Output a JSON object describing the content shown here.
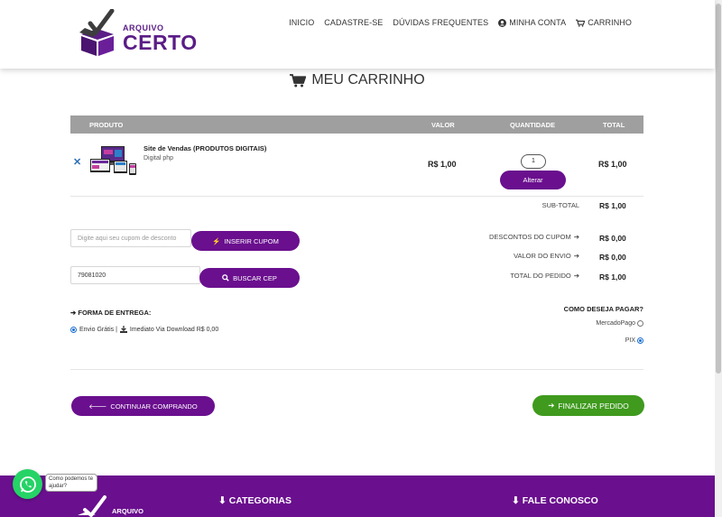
{
  "header": {
    "logo_small": "ARQUIVO",
    "logo_big": "CERTO",
    "nav": [
      "INICIO",
      "CADASTRE-SE",
      "DÚVIDAS FREQUENTES",
      "MINHA CONTA",
      "CARRINHO"
    ]
  },
  "page": {
    "title": "MEU CARRINHO"
  },
  "cart": {
    "columns": [
      "PRODUTO",
      "VALOR",
      "QUANTIDADE",
      "TOTAL"
    ],
    "item": {
      "name": "Site de Vendas (PRODUTOS DIGITAIS)",
      "sub": "Digital php",
      "price": "R$ 1,00",
      "qty": "1",
      "update_label": "Alterar",
      "total": "R$ 1,00"
    },
    "subtotal_label": "SUB-TOTAL",
    "subtotal": "R$ 1,00",
    "discount_label": "DESCONTOS DO CUPOM",
    "discount": "R$ 0,00",
    "shipping_label": "VALOR DO ENVIO",
    "shipping": "R$ 0,00",
    "order_total_label": "TOTAL DO PEDIDO",
    "order_total": "R$ 1,00"
  },
  "coupon": {
    "placeholder": "Digite aqui seu cupom de desconto",
    "button": "INSERIR CUPOM"
  },
  "cep": {
    "value": "79081020",
    "button": "BUSCAR CEP"
  },
  "delivery": {
    "title": "FORMA DE ENTREGA:",
    "option_a": "Envio Grátis |",
    "option_b": "Imediato Via Download R$ 0,00"
  },
  "payment": {
    "title": "COMO DESEJA PAGAR?",
    "options": [
      "MercadoPago",
      "PIX"
    ],
    "selected": "PIX"
  },
  "actions": {
    "continue": "CONTINUAR COMPRANDO",
    "finalize": "FINALIZAR PEDIDO"
  },
  "footer": {
    "categories": "CATEGORIAS",
    "contact": "FALE CONOSCO",
    "logo_small": "ARQUIVO"
  },
  "whatsapp": {
    "bubble": "Como podemos te ajudar?"
  },
  "colors": {
    "purple": "#6a0f8e",
    "green": "#3f9a1e",
    "header_gray": "#9f9f9f"
  }
}
